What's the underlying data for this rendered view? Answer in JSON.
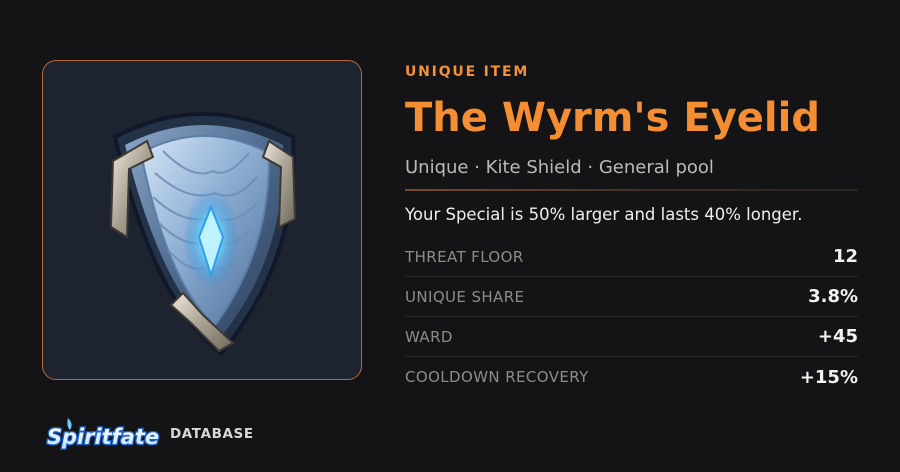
{
  "item": {
    "image_alt": "Kite shield with crystal-blue scale plating and silver corners",
    "eyebrow": "UNIQUE ITEM",
    "title": "The Wyrm's Eyelid",
    "subtitle": "Unique · Kite Shield · General pool",
    "description": "Your Special is 50% larger and lasts 40% longer."
  },
  "stats": [
    {
      "label": "THREAT FLOOR",
      "value": "12"
    },
    {
      "label": "UNIQUE SHARE",
      "value": "3.8%"
    },
    {
      "label": "WARD",
      "value": "+45"
    },
    {
      "label": "COOLDOWN RECOVERY",
      "value": "+15%"
    }
  ],
  "brand": {
    "logo_text": "Spiritfate",
    "label": "DATABASE"
  },
  "colors": {
    "accent": "#f58d32",
    "background": "#141416",
    "frame_border": "#b8683a"
  }
}
